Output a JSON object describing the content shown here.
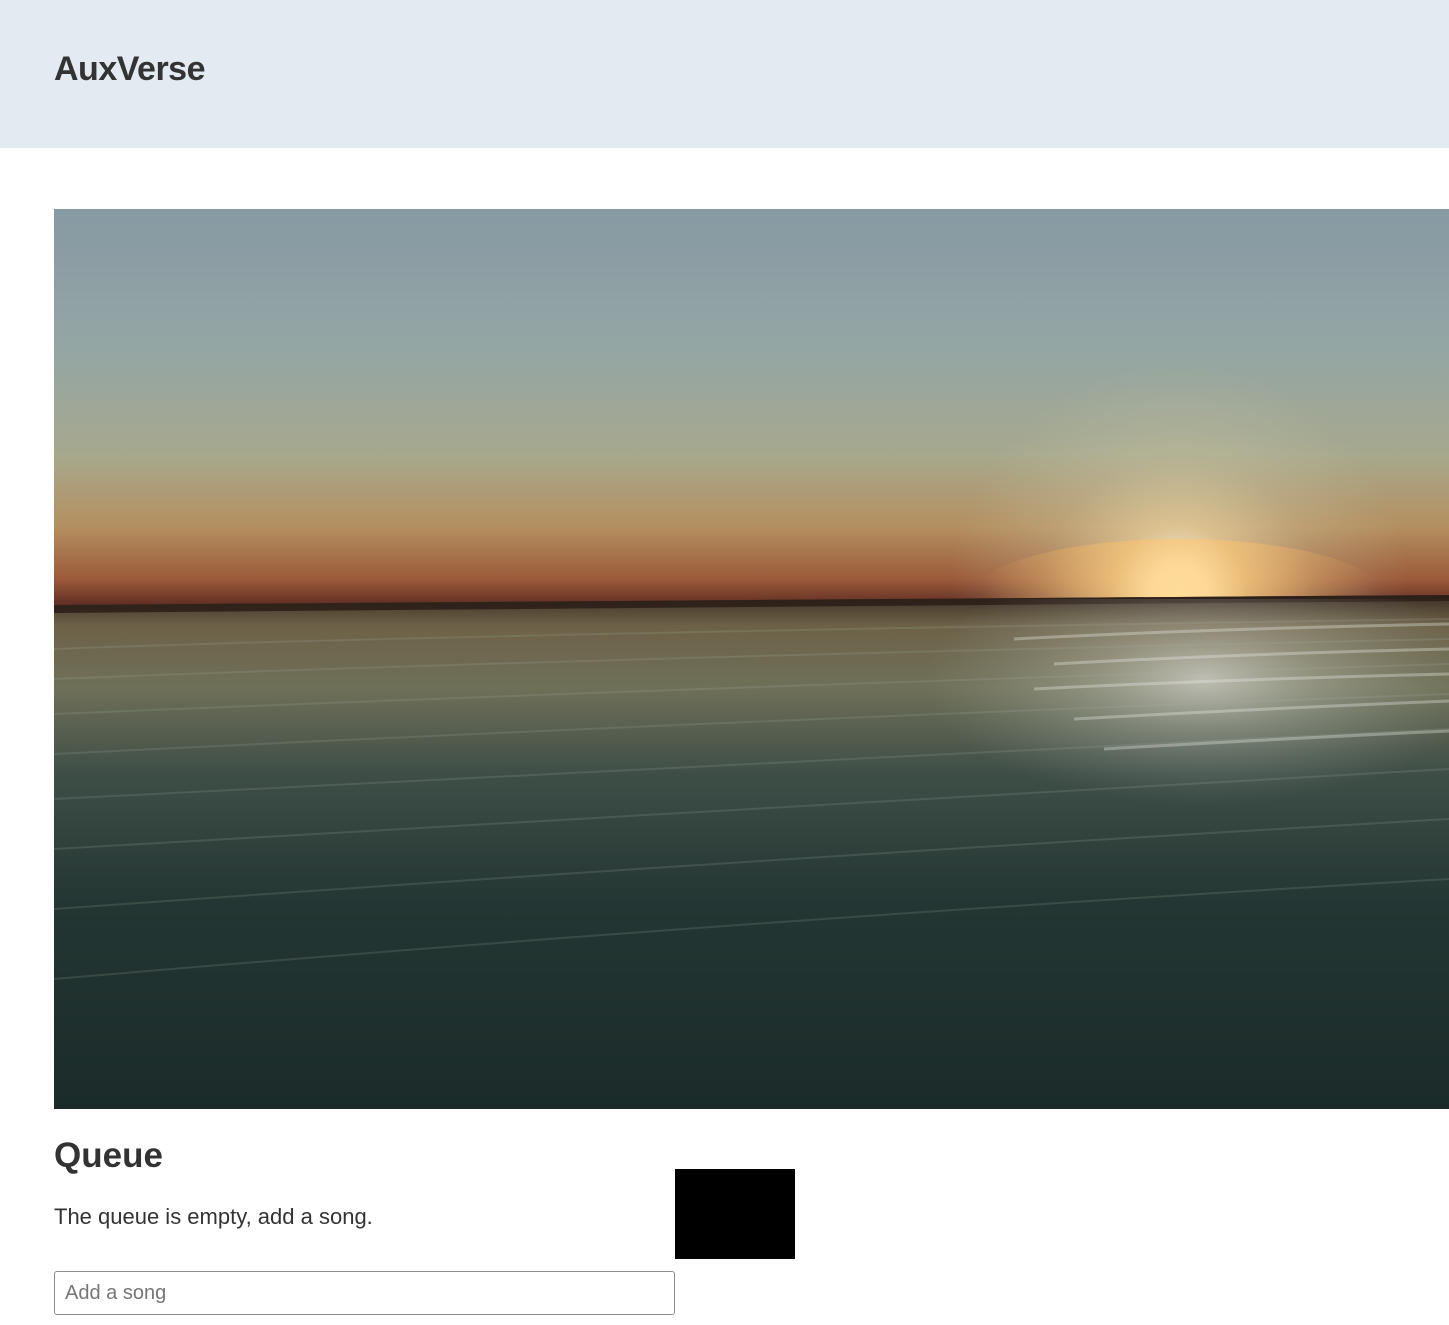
{
  "app": {
    "title": "AuxVerse"
  },
  "visual": {
    "description_icon": "ocean-sunset-visualizer"
  },
  "queue": {
    "title": "Queue",
    "empty_message": "The queue is empty, add a song.",
    "input_placeholder": "Add a song",
    "input_value": ""
  },
  "colors": {
    "header_bg": "#e3eaf2",
    "text": "#333333",
    "player_bg": "#000000"
  }
}
